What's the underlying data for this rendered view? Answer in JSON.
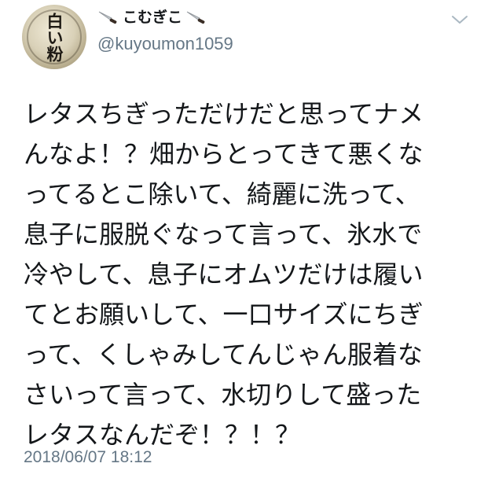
{
  "tweet": {
    "avatar": {
      "logo_text": "白い粉"
    },
    "author": {
      "display_name": "こむぎこ",
      "handle": "@kuyoumon1059",
      "name_decoration_icon": "kitchen-knife-icon"
    },
    "menu_icon": "chevron-down-icon",
    "body_lines": [
      "レタスちぎっただけだと思ってナメ",
      "んなよ！？畑からとってきて悪くな",
      "ってるとこ除いて、綺麗に洗って、",
      "息子に服脱ぐなって言って、氷水で",
      "冷やして、息子にオムツだけは履い",
      "てとお願いして、一口サイズにちぎ",
      "って、くしゃみしてんじゃん服着な",
      "さいって言って、水切りして盛った",
      "レタスなんだぞ！？！？"
    ],
    "timestamp": "2018/06/07 18:12"
  },
  "colors": {
    "text_primary": "#14171a",
    "text_secondary": "#657786",
    "background": "#ffffff"
  }
}
